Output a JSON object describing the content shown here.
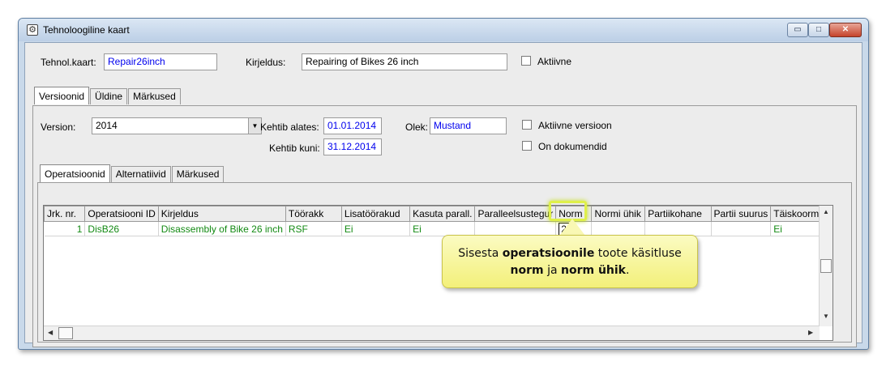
{
  "window": {
    "title": "Tehnoloogiline kaart",
    "icon": "gear-icon",
    "controls": {
      "minimize": "▭",
      "maximize": "□",
      "close": "✕"
    }
  },
  "header": {
    "tehnol_kaart_label": "Tehnol.kaart:",
    "tehnol_kaart_value": "Repair26inch",
    "kirjeldus_label": "Kirjeldus:",
    "kirjeldus_value": "Repairing of Bikes 26 inch",
    "aktiivne_label": "Aktiivne"
  },
  "main_tabs": [
    "Versioonid",
    "Üldine",
    "Märkused"
  ],
  "version": {
    "version_label": "Version:",
    "version_value": "2014",
    "kehtib_alates_label": "Kehtib alates:",
    "kehtib_alates_value": "01.01.2014",
    "kehtib_kuni_label": "Kehtib kuni:",
    "kehtib_kuni_value": "31.12.2014",
    "olek_label": "Olek:",
    "olek_value": "Mustand",
    "aktiivne_versioon_label": "Aktiivne versioon",
    "on_dokumendid_label": "On dokumendid"
  },
  "sub_tabs": [
    "Operatsioonid",
    "Alternatiivid",
    "Märkused"
  ],
  "grid": {
    "columns": [
      "Jrk. nr.",
      "Operatsiooni ID",
      "Kirjeldus",
      "Töörakk",
      "Lisatöörakud",
      "Kasuta parall.",
      "Paralleelsustegur",
      "Norm",
      "Normi ühik",
      "Partiikohane",
      "Partii suurus",
      "Täiskoormus"
    ],
    "rows": [
      [
        "1",
        "DisB26",
        "Disassembly of Bike 26 inch",
        "RSF",
        "Ei",
        "Ei",
        "",
        "25",
        "",
        "",
        "",
        "Ei"
      ]
    ]
  },
  "callout": {
    "part1": "Sisesta ",
    "bold1": "operatsioonile",
    "part2": " toote käsitluse",
    "bold2": "norm",
    "part3": " ja ",
    "bold3": "norm ühik",
    "part4": "."
  },
  "colors": {
    "field_value": "#0000ee",
    "grid_value": "#138a13",
    "callout_bg": "#f3f07a",
    "highlight": "#dff04a"
  }
}
